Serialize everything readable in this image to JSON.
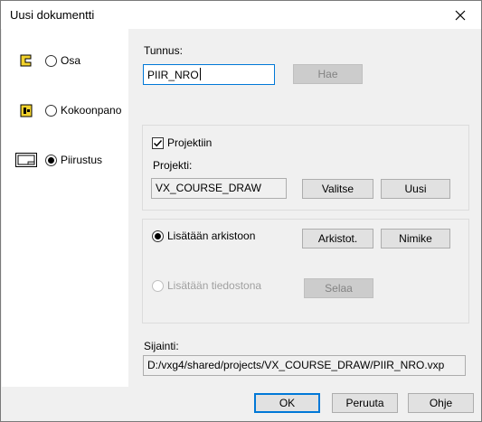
{
  "window": {
    "title": "Uusi dokumentti"
  },
  "doc_types": [
    {
      "label": "Osa",
      "checked": false,
      "icon": "part-icon"
    },
    {
      "label": "Kokoonpano",
      "checked": false,
      "icon": "assembly-icon"
    },
    {
      "label": "Piirustus",
      "checked": true,
      "icon": "drawing-icon"
    }
  ],
  "tunnus": {
    "label": "Tunnus:",
    "value": "PIIR_NRO",
    "hae_label": "Hae"
  },
  "project": {
    "checkbox_label": "Projektiin",
    "checked": true,
    "field_label": "Projekti:",
    "value": "VX_COURSE_DRAW",
    "valitse_label": "Valitse",
    "uusi_label": "Uusi"
  },
  "storage": {
    "archive_label": "Lisätään arkistoon",
    "archive_checked": true,
    "arkistot_label": "Arkistot.",
    "nimike_label": "Nimike",
    "file_label": "Lisätään tiedostona",
    "file_checked": false,
    "selaa_label": "Selaa"
  },
  "location": {
    "label": "Sijainti:",
    "value": "D:/vxg4/shared/projects/VX_COURSE_DRAW/PIIR_NRO.vxp"
  },
  "footer": {
    "ok_label": "OK",
    "cancel_label": "Peruuta",
    "help_label": "Ohje"
  }
}
